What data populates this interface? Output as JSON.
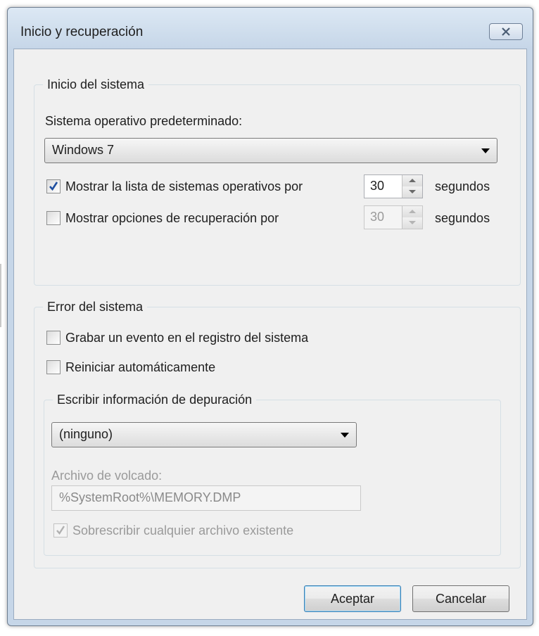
{
  "window": {
    "title": "Inicio y recuperación",
    "close_icon": "close-x-icon"
  },
  "startup": {
    "group_label": "Inicio del sistema",
    "default_os_label": "Sistema operativo predeterminado:",
    "default_os_value": "Windows 7",
    "show_list": {
      "checked": true,
      "label": "Mostrar la lista de sistemas operativos por",
      "value": "30",
      "unit": "segundos"
    },
    "show_recovery": {
      "checked": false,
      "label": "Mostrar opciones de recuperación por",
      "value": "30",
      "unit": "segundos"
    }
  },
  "system_failure": {
    "group_label": "Error del sistema",
    "write_event": {
      "checked": false,
      "label": "Grabar un evento en el registro del sistema"
    },
    "auto_restart": {
      "checked": false,
      "label": "Reiniciar automáticamente"
    },
    "debug": {
      "group_label": "Escribir información de depuración",
      "type_value": "(ninguno)",
      "dump_file_label": "Archivo de volcado:",
      "dump_file_value": "%SystemRoot%\\MEMORY.DMP",
      "overwrite": {
        "checked": true,
        "disabled": true,
        "label": "Sobrescribir cualquier archivo existente"
      }
    }
  },
  "buttons": {
    "ok": "Aceptar",
    "cancel": "Cancelar"
  },
  "colors": {
    "window_frame": "#c6d6e8",
    "client_bg": "#f0f0f0",
    "disabled_text": "#9a9a9a",
    "check_mark": "#1f4fa0"
  }
}
